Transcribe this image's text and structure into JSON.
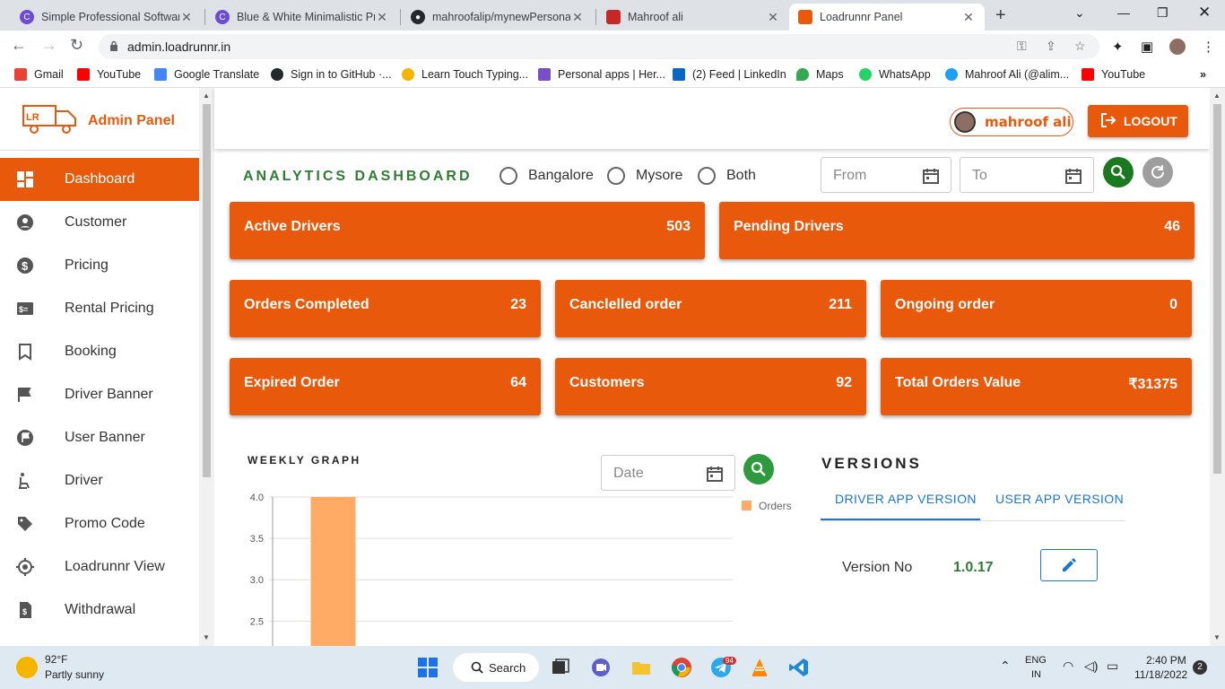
{
  "browser": {
    "tabs": [
      {
        "title": "Simple Professional Software",
        "active": false
      },
      {
        "title": "Blue & White Minimalistic Pr",
        "active": false
      },
      {
        "title": "mahroofalip/mynewPersonal",
        "active": false
      },
      {
        "title": "Mahroof ali",
        "active": false
      },
      {
        "title": "Loadrunnr Panel",
        "active": true
      }
    ],
    "url": "admin.loadrunnr.in",
    "bookmarks": [
      {
        "label": "Gmail",
        "color": "#ea4335"
      },
      {
        "label": "YouTube",
        "color": "#ff0000"
      },
      {
        "label": "Google Translate",
        "color": "#4285f4"
      },
      {
        "label": "Sign in to GitHub ·...",
        "color": "#24292e"
      },
      {
        "label": "Learn Touch Typing...",
        "color": "#f4b400"
      },
      {
        "label": "Personal apps | Her...",
        "color": "#7b4fc4"
      },
      {
        "label": "(2) Feed | LinkedIn",
        "color": "#0a66c2"
      },
      {
        "label": "Maps",
        "color": "#34a853"
      },
      {
        "label": "WhatsApp",
        "color": "#25d366"
      },
      {
        "label": "Mahroof Ali (@alim...",
        "color": "#1da1f2"
      },
      {
        "label": "YouTube",
        "color": "#ff0000"
      }
    ]
  },
  "sidebar": {
    "brand": "Admin Panel",
    "items": [
      {
        "label": "Dashboard",
        "icon": "dashboard-icon",
        "active": true
      },
      {
        "label": "Customer",
        "icon": "account-circle-icon",
        "active": false
      },
      {
        "label": "Pricing",
        "icon": "dollar-icon",
        "active": false
      },
      {
        "label": "Rental Pricing",
        "icon": "price-tag-icon",
        "active": false
      },
      {
        "label": "Booking",
        "icon": "bookmark-icon",
        "active": false
      },
      {
        "label": "Driver Banner",
        "icon": "flag-icon",
        "active": false
      },
      {
        "label": "User Banner",
        "icon": "flag-circle-icon",
        "active": false
      },
      {
        "label": "Driver",
        "icon": "seat-icon",
        "active": false
      },
      {
        "label": "Promo Code",
        "icon": "tag-icon",
        "active": false
      },
      {
        "label": "Loadrunnr View",
        "icon": "location-icon",
        "active": false
      },
      {
        "label": "Withdrawal",
        "icon": "receipt-icon",
        "active": false
      }
    ]
  },
  "topbar": {
    "username": "mahroof ali",
    "logout_label": "LOGOUT"
  },
  "dashboard": {
    "title": "ANALYTICS DASHBOARD",
    "cities": [
      "Bangalore",
      "Mysore",
      "Both"
    ],
    "from_placeholder": "From",
    "to_placeholder": "To",
    "cards": [
      {
        "label": "Active Drivers",
        "value": "503"
      },
      {
        "label": "Pending Drivers",
        "value": "46"
      },
      {
        "label": "Orders Completed",
        "value": "23"
      },
      {
        "label": "Canclelled order",
        "value": "211"
      },
      {
        "label": "Ongoing order",
        "value": "0"
      },
      {
        "label": "Expired Order",
        "value": "64"
      },
      {
        "label": "Customers",
        "value": "92"
      },
      {
        "label": "Total Orders Value",
        "value": "₹31375"
      }
    ],
    "accent": "#e8590c",
    "green": "#2e7d32"
  },
  "weekly": {
    "title": "WEEKLY GRAPH",
    "date_placeholder": "Date"
  },
  "chart_data": {
    "type": "bar",
    "categories": [
      "",
      ""
    ],
    "series": [
      {
        "name": "Orders",
        "values": [
          4,
          0
        ]
      }
    ],
    "yticks": [
      "4.0",
      "3.5",
      "3.0",
      "2.5"
    ],
    "ylim": [
      2.2,
      4.0
    ],
    "color": "#ffab66"
  },
  "versions": {
    "title": "VERSIONS",
    "tabs": [
      "DRIVER APP VERSION",
      "USER APP VERSION"
    ],
    "label": "Version No",
    "value": "1.0.17"
  },
  "taskbar": {
    "temp": "92°F",
    "weather": "Partly sunny",
    "search": "Search",
    "lang1": "ENG",
    "lang2": "IN",
    "time": "2:40 PM",
    "date": "11/18/2022",
    "notif": "2",
    "badge": "94"
  }
}
